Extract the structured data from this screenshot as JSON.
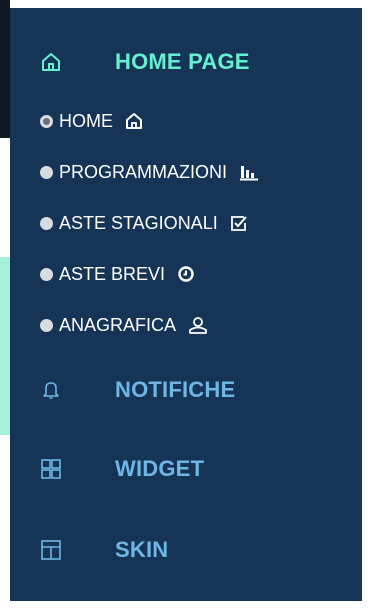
{
  "menu": {
    "home_page": {
      "label": "HOME PAGE",
      "icon": "home-icon"
    },
    "sub_items": [
      {
        "label": "HOME",
        "icon": "home-icon",
        "selected": true
      },
      {
        "label": "PROGRAMMAZIONI",
        "icon": "bar-chart-icon",
        "selected": false
      },
      {
        "label": "ASTE STAGIONALI",
        "icon": "checkbox-icon",
        "selected": false
      },
      {
        "label": "ASTE BREVI",
        "icon": "clock-icon",
        "selected": false
      },
      {
        "label": "ANAGRAFICA",
        "icon": "user-icon",
        "selected": false
      }
    ],
    "notifiche": {
      "label": "NOTIFICHE",
      "icon": "bell-icon"
    },
    "widget": {
      "label": "WIDGET",
      "icon": "grid-icon"
    },
    "skin": {
      "label": "SKIN",
      "icon": "layout-icon"
    }
  },
  "colors": {
    "sidebar_bg": "#163456",
    "active_accent": "#66f0d1",
    "inactive_accent": "#6eb6e6",
    "sub_text": "#ffffff"
  }
}
